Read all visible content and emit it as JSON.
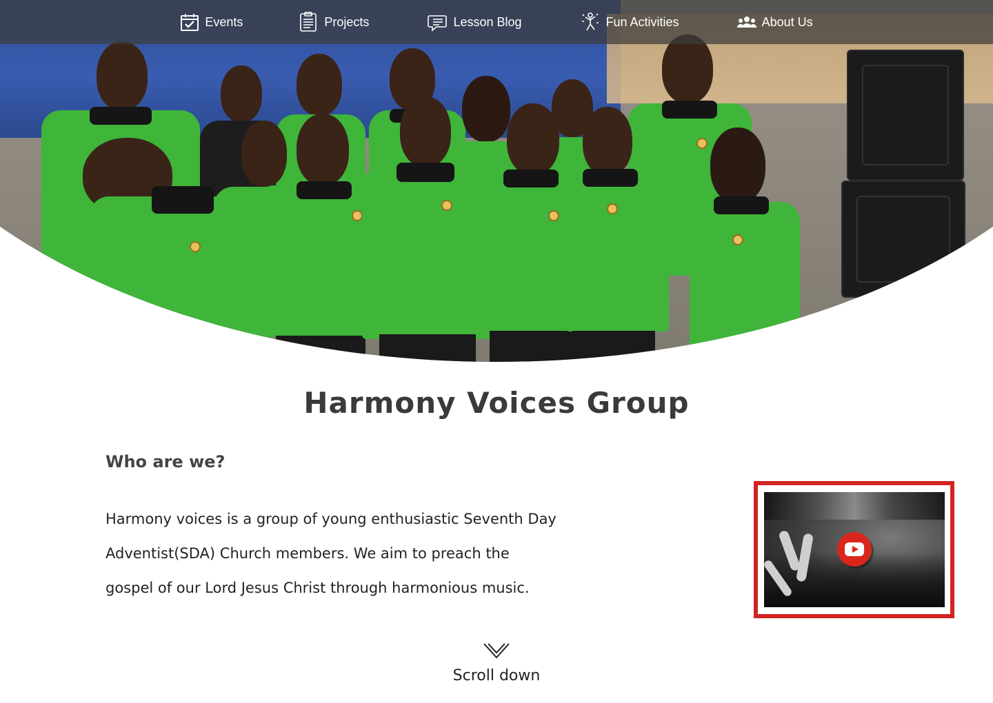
{
  "nav": {
    "items": [
      {
        "label": "Events",
        "icon": "calendar-check-icon"
      },
      {
        "label": "Projects",
        "icon": "clipboard-list-icon"
      },
      {
        "label": "Lesson Blog",
        "icon": "chat-bubble-icon"
      },
      {
        "label": "Fun Activities",
        "icon": "dancing-person-icon"
      },
      {
        "label": "About Us",
        "icon": "people-group-icon"
      }
    ]
  },
  "main": {
    "title": "Harmony Voices Group",
    "subtitle": "Who are we?",
    "description": "Harmony voices is a group of young enthusiastic Seventh Day Adventist(SDA) Church members. We aim to preach the gospel of our Lord Jesus Christ through harmonious music."
  },
  "video": {
    "icon": "youtube-play-icon",
    "frame_color": "#d32320"
  },
  "scroll": {
    "label": "Scroll down",
    "icon": "chevron-down-icon"
  },
  "colors": {
    "shirt_green": "#3fb53a",
    "nav_bg": "#3c3c3c",
    "accent_red": "#d32320"
  }
}
